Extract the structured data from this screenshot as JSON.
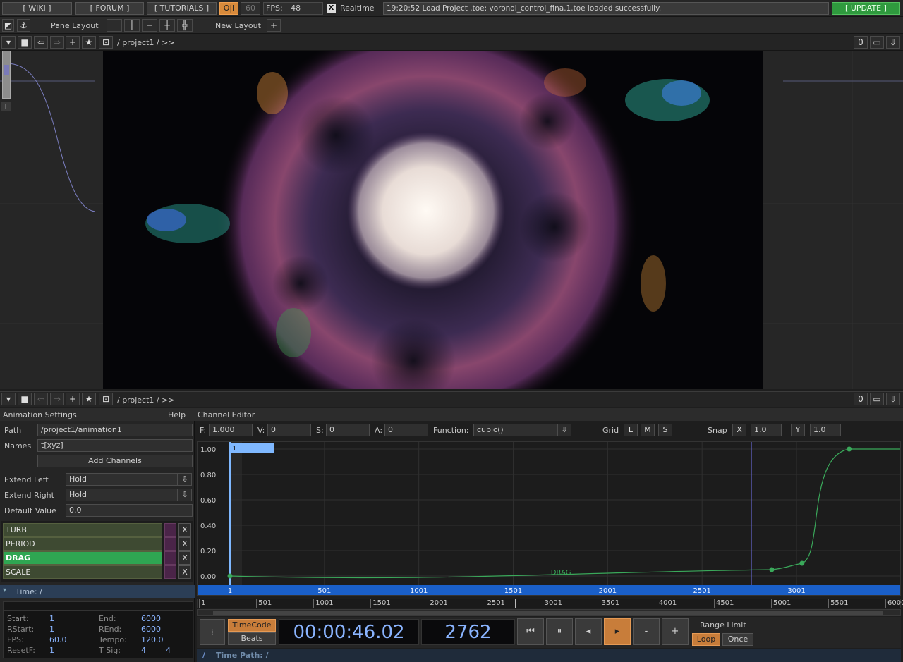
{
  "topbar": {
    "wiki": "[ WIKI ]",
    "forum": "[ FORUM ]",
    "tutorials": "[ TUTORIALS ]",
    "oi": "O|I",
    "fps_limit": "60",
    "fps_label": "FPS:",
    "fps_value": "48",
    "realtime_check": "X",
    "realtime": "Realtime",
    "status": "19:20:52 Load Project .toe: voronoi_control_fina.1.toe loaded successfully.",
    "update": "[ UPDATE ]"
  },
  "layoutbar": {
    "pane_layout": "Pane Layout",
    "new_layout": "New Layout",
    "plus": "+"
  },
  "pane1": {
    "path": "/  project1  /  >>",
    "counter": "0"
  },
  "pane2": {
    "path": "/  project1  /  >>",
    "counter": "0"
  },
  "anim": {
    "title": "Animation Settings",
    "help": "Help",
    "path_label": "Path",
    "path_value": "/project1/animation1",
    "names_label": "Names",
    "names_value": "t[xyz]",
    "add_channels": "Add Channels",
    "extend_left_label": "Extend Left",
    "extend_left_value": "Hold",
    "extend_right_label": "Extend Right",
    "extend_right_value": "Hold",
    "default_label": "Default Value",
    "default_value": "0.0",
    "channels": [
      {
        "name": "TURB",
        "selected": false
      },
      {
        "name": "PERIOD",
        "selected": false
      },
      {
        "name": "DRAG",
        "selected": true
      },
      {
        "name": "SCALE",
        "selected": false
      }
    ],
    "x": "X",
    "time_label": "Time: /",
    "time_info": {
      "start_l": "Start:",
      "start_v": "1",
      "end_l": "End:",
      "end_v": "6000",
      "rstart_l": "RStart:",
      "rstart_v": "1",
      "rend_l": "REnd:",
      "rend_v": "6000",
      "fps_l": "FPS:",
      "fps_v": "60.0",
      "tempo_l": "Tempo:",
      "tempo_v": "120.0",
      "resetf_l": "ResetF:",
      "resetf_v": "1",
      "tsig_l": "T Sig:",
      "tsig_a": "4",
      "tsig_b": "4"
    }
  },
  "channel_editor": {
    "title": "Channel Editor",
    "f_label": "F:",
    "f_value": "1.000",
    "v_label": "V:",
    "v_value": "0",
    "s_label": "S:",
    "s_value": "0",
    "a_label": "A:",
    "a_value": "0",
    "function_label": "Function:",
    "function_value": "cubic()",
    "grid_label": "Grid",
    "grid_l": "L",
    "grid_m": "M",
    "grid_s": "S",
    "snap_label": "Snap",
    "snap_x": "X",
    "snap_x_value": "1.0",
    "snap_y": "Y",
    "snap_y_value": "1.0",
    "cursor_frame": "1",
    "curve_label": "DRAG",
    "y_ticks": [
      "1.00",
      "0.80",
      "0.60",
      "0.40",
      "0.20",
      "0.00"
    ],
    "x_ticks": [
      "1",
      "501",
      "1001",
      "1501",
      "2001",
      "2501",
      "3001"
    ]
  },
  "chart_data": {
    "type": "line",
    "series": [
      {
        "name": "DRAG",
        "points": [
          [
            1,
            0.0
          ],
          [
            2870,
            0.05
          ],
          [
            3030,
            0.1
          ],
          [
            3280,
            1.0
          ]
        ]
      }
    ],
    "xlim": [
      1,
      3550
    ],
    "ylim": [
      0,
      1.0
    ]
  },
  "timeline": {
    "ruler": [
      "1",
      "501",
      "1001",
      "1501",
      "2001",
      "2501",
      "3001",
      "3501",
      "4001",
      "4501",
      "5001",
      "5501",
      "6000"
    ],
    "timecode": "TimeCode",
    "beats": "Beats",
    "time_display": "00:00:46.02",
    "frame_display": "2762",
    "range_limit": "Range Limit",
    "loop": "Loop",
    "once": "Once",
    "time_path_prefix": "/",
    "time_path": "Time Path: /",
    "minus": "-",
    "plus": "+"
  }
}
